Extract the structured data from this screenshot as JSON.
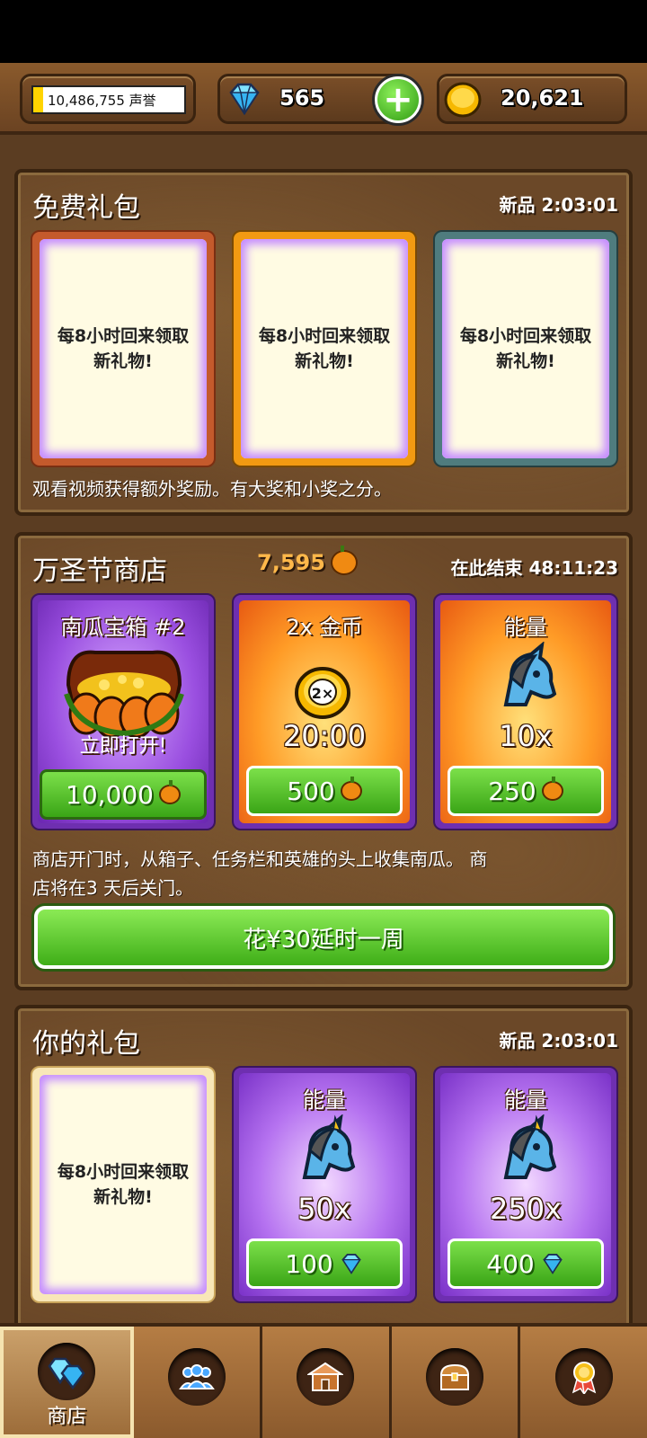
{
  "topbar": {
    "reputation": "10,486,755 声誉",
    "gems": "565",
    "gold": "20,621"
  },
  "free_pack": {
    "title": "免费礼包",
    "timer": "新品 2:03:01",
    "card_text_1": "每8小时回来领取新礼物!",
    "card_text_2": "每8小时回来领取新礼物!",
    "card_text_3": "每8小时回来领取新礼物!",
    "footer": "观看视频获得额外奖励。有大奖和小奖之分。"
  },
  "halloween": {
    "title": "万圣节商店",
    "pumpkins": "7,595",
    "timer": "在此结束 48:11:23",
    "items": [
      {
        "title": "南瓜宝箱 #2",
        "sub": "立即打开!",
        "price": "10,000"
      },
      {
        "title": "2x 金币",
        "sub": "20:00",
        "price": "500"
      },
      {
        "title": "能量",
        "sub": "10x",
        "price": "250"
      }
    ],
    "desc_line1": "商店开门时，从箱子、任务栏和英雄的头上收集南瓜。 商",
    "desc_line2": "店将在3 天后关门。",
    "extend_button": "花¥30延时一周"
  },
  "your_pack": {
    "title": "你的礼包",
    "timer": "新品 2:03:01",
    "card_text": "每8小时回来领取新礼物!",
    "items": [
      {
        "title": "能量",
        "sub": "50x",
        "price": "100"
      },
      {
        "title": "能量",
        "sub": "250x",
        "price": "400"
      }
    ]
  },
  "nav": {
    "shop_label": "商店"
  },
  "colors": {
    "green_button": "#3fae18",
    "panel_brown": "#6b4828",
    "purple_card": "#6e2fb0"
  }
}
